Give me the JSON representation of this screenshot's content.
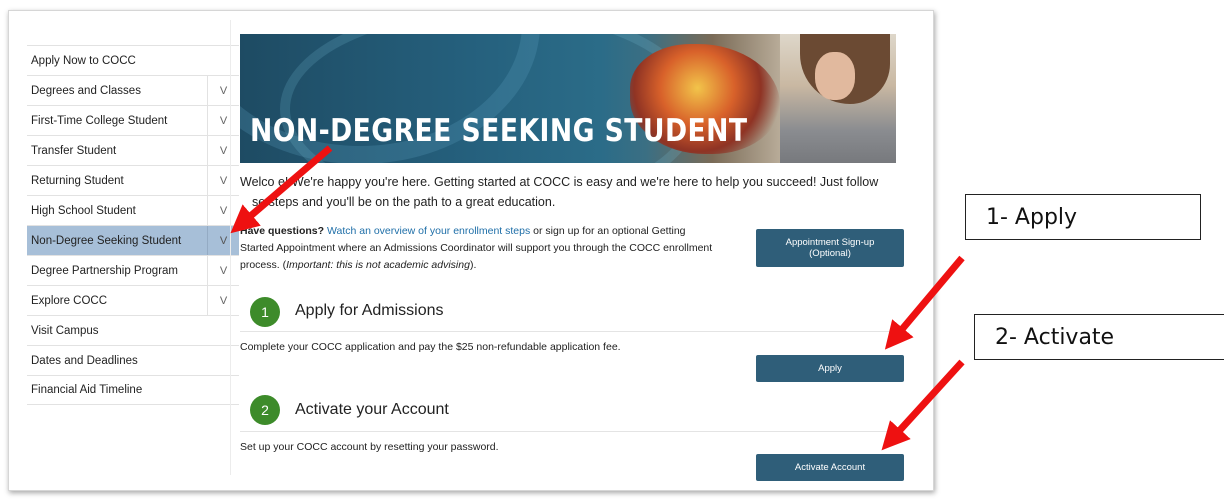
{
  "sidebar": {
    "items": [
      {
        "label": "Apply Now to COCC",
        "toggle": ""
      },
      {
        "label": "Degrees and Classes",
        "toggle": "V"
      },
      {
        "label": "First-Time College Student",
        "toggle": "V"
      },
      {
        "label": "Transfer Student",
        "toggle": "V"
      },
      {
        "label": "Returning Student",
        "toggle": "V"
      },
      {
        "label": "High School Student",
        "toggle": "V"
      },
      {
        "label": "Non-Degree Seeking Student",
        "toggle": "V",
        "active": true
      },
      {
        "label": "Degree Partnership Program",
        "toggle": "V"
      },
      {
        "label": "Explore COCC",
        "toggle": "V"
      },
      {
        "label": "Visit Campus",
        "toggle": ""
      },
      {
        "label": "Dates and Deadlines",
        "toggle": ""
      },
      {
        "label": "Financial Aid Timeline",
        "toggle": ""
      }
    ]
  },
  "banner": {
    "title": "NON-DEGREE SEEKING STUDENT"
  },
  "intro": {
    "line1": "Welco e! We're happy you're here. Getting started at COCC is easy and we're here to help you succeed! Just follow",
    "line2": "se steps and you'll be on the path to a great education."
  },
  "questions": {
    "bold": "Have questions?",
    "link": "Watch an overview of your enrollment steps",
    "text": " or sign up for an optional Getting Started Appointment where an Admissions Coordinator will support you through the COCC enrollment process. (",
    "italic": "Important: this is not academic advising",
    "end": ")."
  },
  "appointment_button": {
    "line1": "Appointment Sign-up",
    "line2": "(Optional)"
  },
  "steps": [
    {
      "number": "1",
      "title": "Apply for Admissions",
      "description": "Complete your COCC application and pay the $25 non-refundable application fee.",
      "button": "Apply"
    },
    {
      "number": "2",
      "title": "Activate your Account",
      "description": "Set up your COCC account by resetting your password.",
      "button": "Activate Account"
    }
  ],
  "callouts": {
    "apply": "1- Apply",
    "activate": "2- Activate"
  },
  "colors": {
    "accent_blue": "#2f5e79",
    "step_green": "#3d8b2a",
    "active_nav": "#a7bfd8",
    "arrow_red": "#ee1111"
  }
}
